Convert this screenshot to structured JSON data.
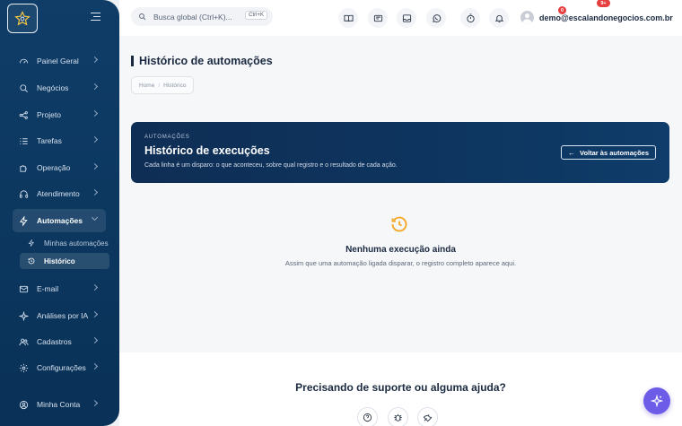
{
  "sidebar": {
    "items": [
      {
        "label": "Painel Geral",
        "icon": "gauge-icon"
      },
      {
        "label": "Negócios",
        "icon": "search-icon"
      },
      {
        "label": "Projeto",
        "icon": "share-nodes-icon"
      },
      {
        "label": "Tarefas",
        "icon": "checklist-icon"
      },
      {
        "label": "Operação",
        "icon": "puzzle-icon"
      },
      {
        "label": "Atendimento",
        "icon": "headset-icon"
      },
      {
        "label": "Automações",
        "icon": "bolt-icon"
      },
      {
        "label": "E-mail",
        "icon": "mail-icon"
      },
      {
        "label": "Análises por IA",
        "icon": "sparkle-icon"
      },
      {
        "label": "Cadastros",
        "icon": "users-icon"
      },
      {
        "label": "Configurações",
        "icon": "gear-icon"
      }
    ],
    "subitems": [
      {
        "label": "Minhas automações",
        "icon": "bolt-icon"
      },
      {
        "label": "Histórico",
        "icon": "history-icon"
      }
    ],
    "account": {
      "label": "Minha Conta",
      "icon": "user-icon"
    }
  },
  "topbar": {
    "search_placeholder": "Busca global (Ctrl+K)...",
    "search_shortcut": "Ctrl+K",
    "whatsapp_badge": "0",
    "timer_badge": "9+",
    "user_email": "demo@escalandonegocios.com.br"
  },
  "page": {
    "title": "Histórico de automações",
    "breadcrumb": [
      "Home",
      "Histórico"
    ]
  },
  "hero": {
    "kicker": "AUTOMAÇÕES",
    "title": "Histórico de execuções",
    "description": "Cada linha é um disparo: o que aconteceu, sobre qual registro e o resultado de cada ação.",
    "back_button": "Voltar às automações"
  },
  "empty_state": {
    "title": "Nenhuma execução ainda",
    "description": "Assim que uma automação ligada disparar, o registro completo aparece aqui."
  },
  "support": {
    "title": "Precisando de suporte ou alguma ajuda?"
  },
  "colors": {
    "sidebar": "#0c3860",
    "hero": "#0f2e55",
    "accent_orange": "#f5a623",
    "fab": "#6c5ce7",
    "badge": "#e53e3e"
  }
}
